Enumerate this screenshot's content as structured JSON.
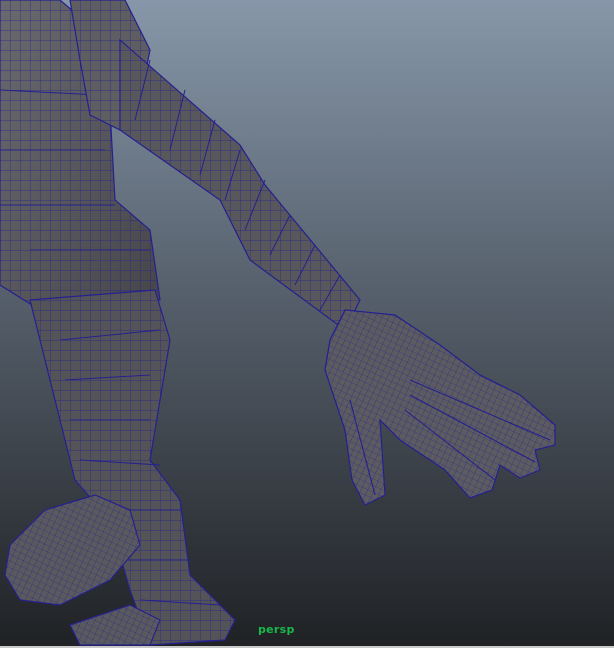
{
  "viewport": {
    "camera_label": "persp",
    "colors": {
      "background_top": "#8797a9",
      "background_bottom": "#1f2124",
      "mesh_fill": "#5a5a5e",
      "mesh_shadow": "#3a3a3e",
      "wireframe": "#25208f",
      "camera_label": "#17b94a"
    }
  }
}
